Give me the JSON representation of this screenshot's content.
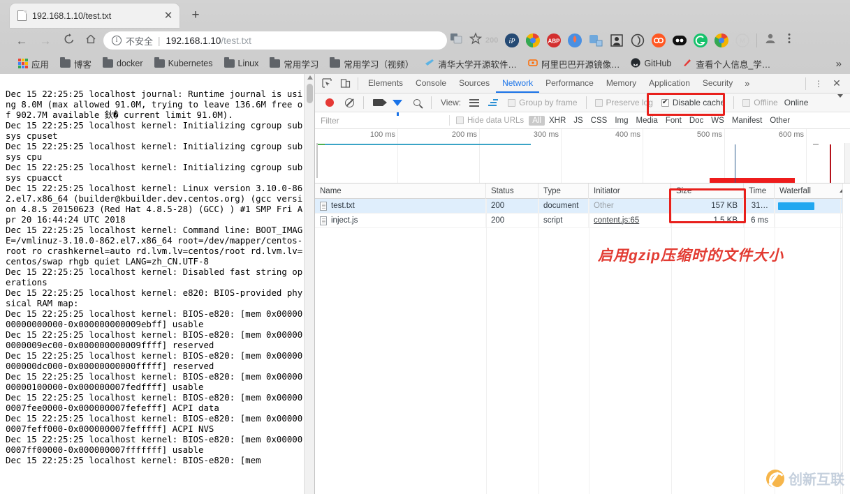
{
  "browser": {
    "tab": {
      "title": "192.168.1.10/test.txt",
      "close_label": "✕"
    },
    "newtab_label": "+",
    "nav": {
      "back": "←",
      "forward": "→",
      "reload": "C",
      "home": "⌂"
    },
    "omnibox": {
      "security_label": "不安全",
      "separator": "|",
      "host": "192.168.1.10",
      "path": "/test.txt",
      "info_icon": "i"
    },
    "toolbar_badge": "200",
    "bookmarks": [
      {
        "label": "应用",
        "icon": "apps-grid-icon"
      },
      {
        "label": "博客",
        "icon": "folder-icon"
      },
      {
        "label": "docker",
        "icon": "folder-icon"
      },
      {
        "label": "Kubernetes",
        "icon": "folder-icon"
      },
      {
        "label": "Linux",
        "icon": "folder-icon"
      },
      {
        "label": "常用学习",
        "icon": "folder-icon"
      },
      {
        "label": "常用学习（视频）",
        "icon": "folder-icon"
      },
      {
        "label": "清华大学开源软件…",
        "icon": "bookmark-favicon"
      },
      {
        "label": "阿里巴巴开源镜像…",
        "icon": "bookmark-favicon"
      },
      {
        "label": "GitHub",
        "icon": "github-icon"
      },
      {
        "label": "查看个人信息_学…",
        "icon": "bookmark-favicon"
      }
    ],
    "bookmarks_overflow": "»"
  },
  "page": {
    "content": "Dec 15 22:25:25 localhost journal: Runtime journal is using 8.0M (max allowed 91.0M, trying to leave 136.6M free of 902.7M available 鈥� current limit 91.0M).\nDec 15 22:25:25 localhost kernel: Initializing cgroup subsys cpuset\nDec 15 22:25:25 localhost kernel: Initializing cgroup subsys cpu\nDec 15 22:25:25 localhost kernel: Initializing cgroup subsys cpuacct\nDec 15 22:25:25 localhost kernel: Linux version 3.10.0-862.el7.x86_64 (builder@kbuilder.dev.centos.org) (gcc version 4.8.5 20150623 (Red Hat 4.8.5-28) (GCC) ) #1 SMP Fri Apr 20 16:44:24 UTC 2018\nDec 15 22:25:25 localhost kernel: Command line: BOOT_IMAGE=/vmlinuz-3.10.0-862.el7.x86_64 root=/dev/mapper/centos-root ro crashkernel=auto rd.lvm.lv=centos/root rd.lvm.lv=centos/swap rhgb quiet LANG=zh_CN.UTF-8\nDec 15 22:25:25 localhost kernel: Disabled fast string operations\nDec 15 22:25:25 localhost kernel: e820: BIOS-provided physical RAM map:\nDec 15 22:25:25 localhost kernel: BIOS-e820: [mem 0x0000000000000000-0x000000000009ebff] usable\nDec 15 22:25:25 localhost kernel: BIOS-e820: [mem 0x000000000009ec00-0x000000000009ffff] reserved\nDec 15 22:25:25 localhost kernel: BIOS-e820: [mem 0x00000000000dc000-0x00000000000fffff] reserved\nDec 15 22:25:25 localhost kernel: BIOS-e820: [mem 0x0000000000100000-0x000000007fedffff] usable\nDec 15 22:25:25 localhost kernel: BIOS-e820: [mem 0x000000007fee0000-0x000000007fefefff] ACPI data\nDec 15 22:25:25 localhost kernel: BIOS-e820: [mem 0x000000007feff000-0x000000007fefffff] ACPI NVS\nDec 15 22:25:25 localhost kernel: BIOS-e820: [mem 0x000000007ff00000-0x000000007fffffff] usable\nDec 15 22:25:25 localhost kernel: BIOS-e820: [mem"
  },
  "devtools": {
    "panels": [
      "Elements",
      "Console",
      "Sources",
      "Network",
      "Performance",
      "Memory",
      "Application",
      "Security"
    ],
    "active_panel": "Network",
    "more_panels_label": "»",
    "menu_label": "⋮",
    "close_label": "✕",
    "toolbar": {
      "view_label": "View:",
      "group_by_frame": "Group by frame",
      "preserve_log": "Preserve log",
      "disable_cache": "Disable cache",
      "offline": "Offline",
      "throttling": "Online",
      "disable_cache_checked": true,
      "preserve_log_checked": false,
      "group_by_frame_checked": false,
      "offline_checked": false
    },
    "filterbar": {
      "filter_placeholder": "Filter",
      "hide_data_urls": "Hide data URLs",
      "types": [
        "All",
        "XHR",
        "JS",
        "CSS",
        "Img",
        "Media",
        "Font",
        "Doc",
        "WS",
        "Manifest",
        "Other"
      ],
      "selected_type": "All"
    },
    "overview": {
      "ticks": [
        "100 ms",
        "200 ms",
        "300 ms",
        "400 ms",
        "500 ms",
        "600 ms"
      ]
    },
    "table": {
      "columns": [
        "Name",
        "Status",
        "Type",
        "Initiator",
        "Size",
        "Time",
        "Waterfall"
      ],
      "rows": [
        {
          "name": "test.txt",
          "status": "200",
          "type": "document",
          "initiator": "Other",
          "initiator_muted": true,
          "size": "157 KB",
          "time": "31…",
          "selected": true
        },
        {
          "name": "inject.js",
          "status": "200",
          "type": "script",
          "initiator": "content.js:65",
          "initiator_muted": false,
          "size": "1.5 KB",
          "time": "6 ms",
          "selected": false
        }
      ]
    }
  },
  "annotations": {
    "gzip_note": "启用gzip压缩时的文件大小",
    "highlight_color": "#e8201c"
  },
  "watermark": {
    "text": "创新互联"
  }
}
